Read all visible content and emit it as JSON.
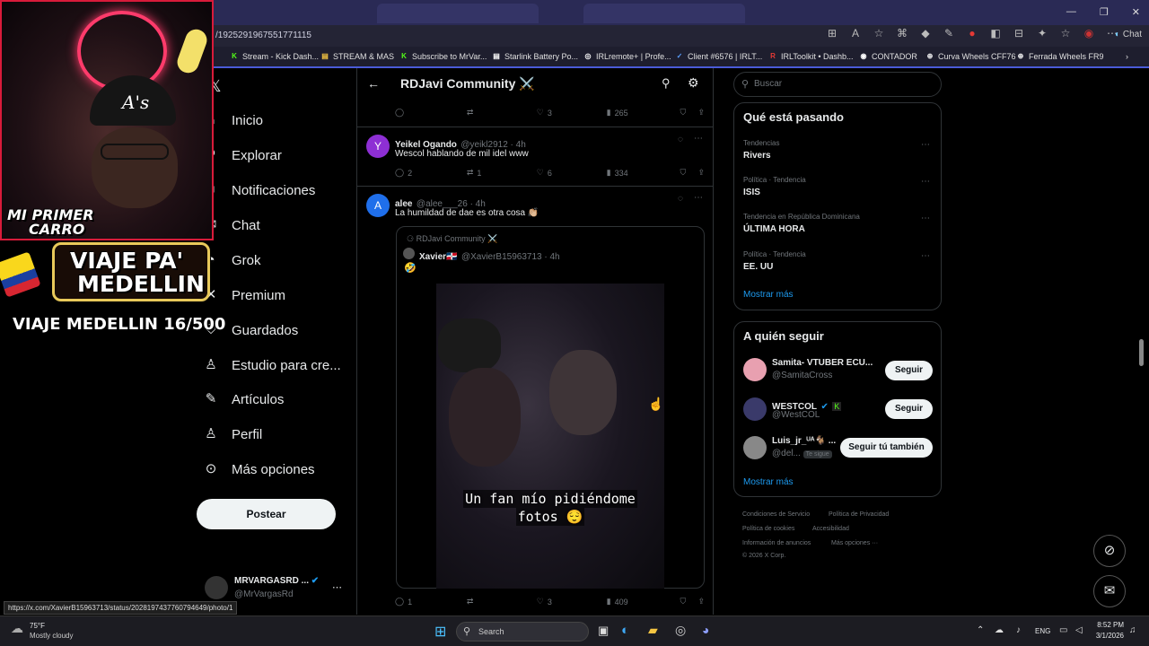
{
  "browser": {
    "url": "/1925291967551771115",
    "copilot_label": "Chat",
    "bookmarks": [
      {
        "label": "Stream - Kick Dash...",
        "icon_color": "#53fc18",
        "icon": "K"
      },
      {
        "label": "STREAM & MAS",
        "icon_color": "#f5c542",
        "icon": "▤"
      },
      {
        "label": "Subscribe to MrVar...",
        "icon_color": "#53fc18",
        "icon": "K"
      },
      {
        "label": "Starlink Battery Po...",
        "icon_color": "#ffffff",
        "icon": "▤"
      },
      {
        "label": "IRLremote+ | Profe...",
        "icon_color": "#ffffff",
        "icon": "◎"
      },
      {
        "label": "Client #6576 | IRLT...",
        "icon_color": "#5aa0ff",
        "icon": "✓"
      },
      {
        "label": "IRLToolkit • Dashb...",
        "icon_color": "#e53935",
        "icon": "R"
      },
      {
        "label": "CONTADOR",
        "icon_color": "#ffffff",
        "icon": "◉"
      },
      {
        "label": "Curva Wheels CFF76",
        "icon_color": "#ffffff",
        "icon": "⊕"
      },
      {
        "label": "Ferrada Wheels FR9",
        "icon_color": "#ffffff",
        "icon": "⊕"
      }
    ]
  },
  "stream_overlay": {
    "badge1": "MI PRIMER",
    "badge2": "CARRO",
    "logo_line1": "VIAJE PA'",
    "logo_line2": "MEDELLIN",
    "counter": "VIAJE MEDELLIN 16/500"
  },
  "nav": {
    "items": [
      {
        "label": "Inicio",
        "icon": "home-icon",
        "glyph": "⌂"
      },
      {
        "label": "Explorar",
        "icon": "search-icon",
        "glyph": "⚲"
      },
      {
        "label": "Notificaciones",
        "icon": "bell-icon",
        "glyph": "🔔"
      },
      {
        "label": "Chat",
        "icon": "chat-icon",
        "glyph": "✉"
      },
      {
        "label": "Grok",
        "icon": "grok-icon",
        "glyph": "◔"
      },
      {
        "label": "Premium",
        "icon": "x-icon",
        "glyph": "✕"
      },
      {
        "label": "Guardados",
        "icon": "bookmark-icon",
        "glyph": "⛉"
      },
      {
        "label": "Estudio para cre...",
        "icon": "studio-icon",
        "glyph": "♙"
      },
      {
        "label": "Artículos",
        "icon": "article-icon",
        "glyph": "✎"
      },
      {
        "label": "Perfil",
        "icon": "person-icon",
        "glyph": "♙"
      },
      {
        "label": "Más opciones",
        "icon": "more-circle-icon",
        "glyph": "⋯"
      }
    ],
    "post_button": "Postear",
    "account_name": "MRVARGASRD ...",
    "account_handle": "@MrVargasRd"
  },
  "community": {
    "title": "RDJavi Community ⚔️",
    "top_actions": {
      "replies": "",
      "reposts": "",
      "likes": "3",
      "views": "265"
    },
    "posts": [
      {
        "avatar_letter": "Y",
        "avatar_color": "#8e2fd4",
        "name": "Yeikel Ogando",
        "handle": "@yeikl2912 · 4h",
        "text": "Wescol hablando de mil idel www",
        "replies": "2",
        "reposts": "1",
        "likes": "6",
        "views": "334"
      },
      {
        "avatar_letter": "A",
        "avatar_color": "#1f6feb",
        "name": "alee",
        "handle": "@alee___26 · 4h",
        "text": "La humildad de dae es otra cosa 👏🏼",
        "replies": "1",
        "reposts": "",
        "likes": "3",
        "views": "409",
        "quote": {
          "community": "RDJavi Community ⚔️",
          "name": "Xavier🇩🇴",
          "handle": "@XavierB15963713 · 4h",
          "text": "🤣",
          "video_caption_line1": "Un fan mío pidiéndome",
          "video_caption_line2": "fotos 😌"
        }
      }
    ]
  },
  "right": {
    "search_placeholder": "Buscar",
    "trending_title": "Qué está pasando",
    "trends": [
      {
        "category": "Tendencias",
        "name": "Rivers"
      },
      {
        "category": "Política · Tendencia",
        "name": "ISIS"
      },
      {
        "category": "Tendencia en República Dominicana",
        "name": "ÚLTIMA HORA"
      },
      {
        "category": "Política · Tendencia",
        "name": "EE. UU"
      }
    ],
    "show_more": "Mostrar más",
    "follow_title": "A quién seguir",
    "follow": [
      {
        "name": "Samita- VTUBER ECU...",
        "handle": "@SamitaCross",
        "button": "Seguir",
        "avatar_color": "#e8a0b0"
      },
      {
        "name": "WESTCOL",
        "handle": "@WestCOL",
        "button": "Seguir",
        "avatar_color": "#3a3a6a"
      },
      {
        "name": "Luis_jr_ᵁᴬ🐐 ...",
        "handle": "@del...",
        "badge": "Te sigue",
        "button": "Seguir tú también",
        "avatar_color": "#888"
      }
    ],
    "footer": [
      "Condiciones de Servicio",
      "Política de Privacidad",
      "Política de cookies",
      "Accesibilidad",
      "Información de anuncios",
      "Más opciones ···",
      "© 2026 X Corp."
    ]
  },
  "status_url": "https://x.com/XavierB15963713/status/2028197437760794649/photo/1",
  "taskbar": {
    "weather_temp": "75°F",
    "weather_desc": "Mostly cloudy",
    "search": "Search",
    "lang": "ENG",
    "time": "8:52 PM",
    "date": "3/1/2026"
  }
}
